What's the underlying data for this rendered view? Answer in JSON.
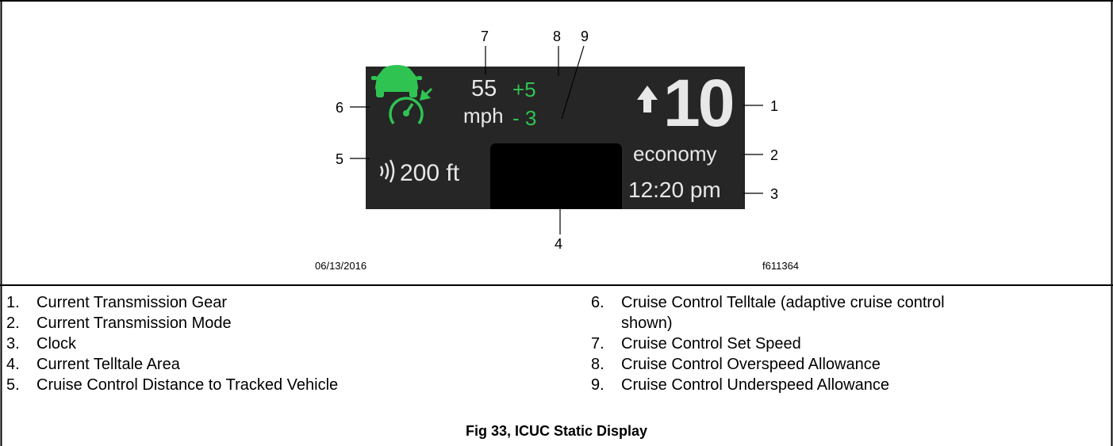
{
  "figure": {
    "date": "06/13/2016",
    "code": "f611364",
    "caption": "Fig 33, ICUC Static Display"
  },
  "display": {
    "set_speed": "55",
    "set_speed_unit": "mph",
    "overspeed": "+5",
    "underspeed": "- 3",
    "gear": "10",
    "mode": "economy",
    "clock": "12:20 pm",
    "distance": "200 ft",
    "colors": {
      "background": "#262626",
      "accent": "#2fc452",
      "text": "#e8e8e8",
      "telltale_area": "#000000"
    }
  },
  "callouts": [
    "1",
    "2",
    "3",
    "4",
    "5",
    "6",
    "7",
    "8",
    "9"
  ],
  "legend": {
    "left": [
      {
        "num": "1.",
        "text": "Current Transmission Gear"
      },
      {
        "num": "2.",
        "text": "Current Transmission Mode"
      },
      {
        "num": "3.",
        "text": "Clock"
      },
      {
        "num": "4.",
        "text": "Current Telltale Area"
      },
      {
        "num": "5.",
        "text": "Cruise Control Distance to Tracked Vehicle"
      }
    ],
    "right": [
      {
        "num": "6.",
        "text": "Cruise Control Telltale (adaptive cruise control"
      },
      {
        "num": "",
        "text": "shown)"
      },
      {
        "num": "7.",
        "text": "Cruise Control Set Speed"
      },
      {
        "num": "8.",
        "text": "Cruise Control Overspeed Allowance"
      },
      {
        "num": "9.",
        "text": "Cruise Control Underspeed Allowance"
      }
    ]
  }
}
